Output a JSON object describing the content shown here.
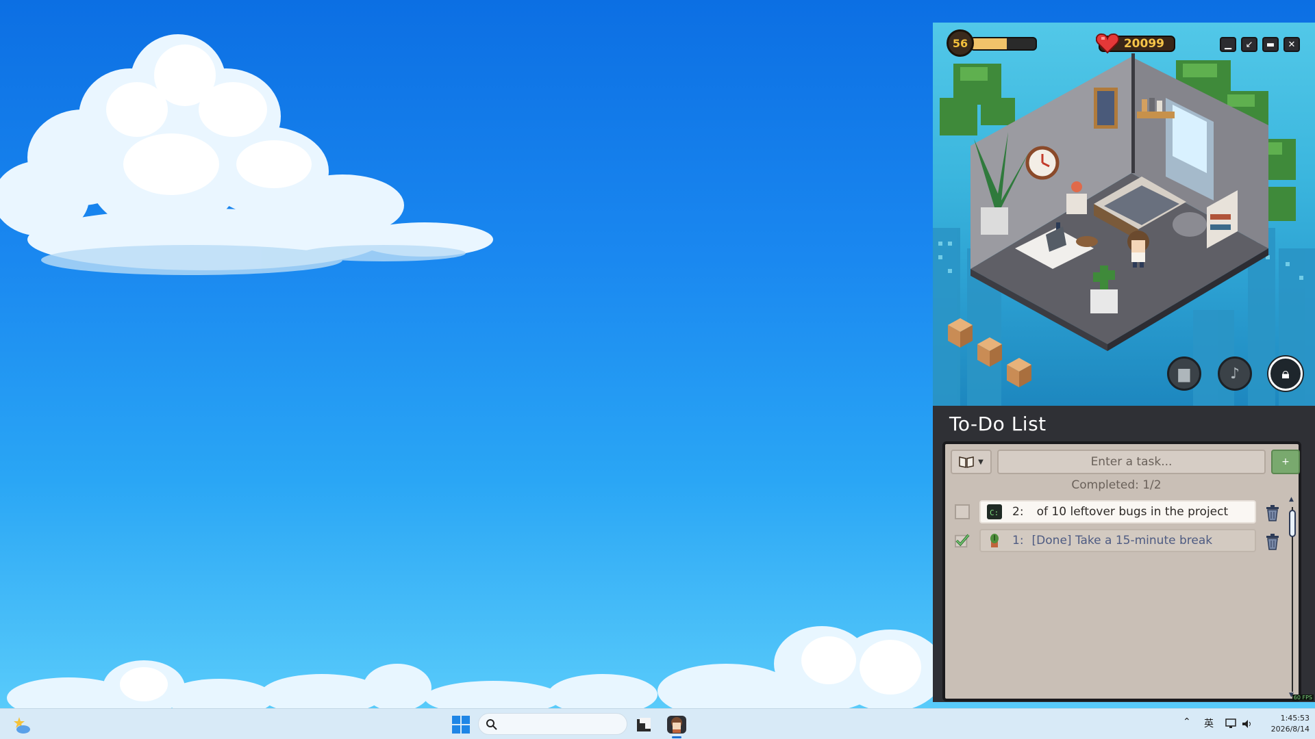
{
  "hud": {
    "level": "56",
    "xp_fraction": 0.55,
    "hearts": "20099"
  },
  "window_controls": {
    "minimize_icon": "minimize-icon",
    "shrink_icon": "shrink-icon",
    "compact_icon": "compact-icon",
    "close_icon": "close-icon"
  },
  "scene_buttons": [
    "chat-icon",
    "music-icon",
    "lock-icon"
  ],
  "todo": {
    "title": "To-Do List",
    "input_placeholder": "Enter a task...",
    "add_label": "+",
    "completed_text": "Completed: 1/2",
    "tasks": [
      {
        "num": "2:",
        "text": "  of 10 leftover bugs in the project",
        "done": false,
        "icon": "terminal-icon"
      },
      {
        "num": "1:",
        "text": "[Done] Take a 15-minute break",
        "done": true,
        "icon": "plant-icon"
      }
    ]
  },
  "fps": "60 FPS",
  "taskbar": {
    "ime": "英",
    "time": "1:45:53",
    "date": "2026/8/14"
  },
  "colors": {
    "accent_green": "#79a96e",
    "card_bg": "#c9bfb6",
    "done_text": "#4e5b82"
  }
}
